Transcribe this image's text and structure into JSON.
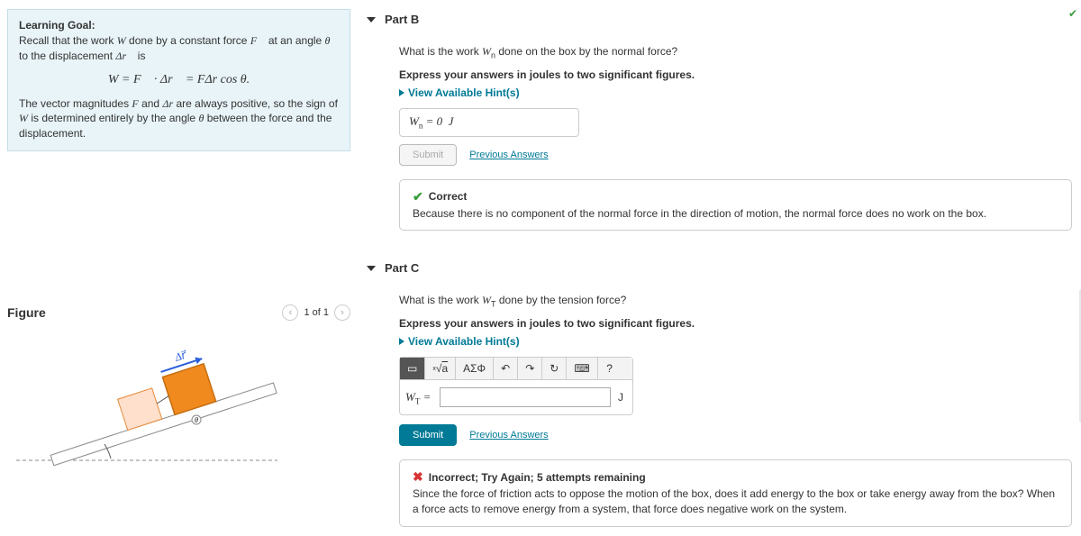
{
  "sidebar": {
    "lg_title": "Learning Goal:",
    "lg_line1_pre": "Recall that the work ",
    "lg_line1_post": " is",
    "formula": "W = F⃗ · Δr⃗ = FΔr cos θ.",
    "lg_line2": "The vector magnitudes F and Δr are always positive, so the sign of W is determined entirely by the angle θ between the force and the displacement.",
    "figure_title": "Figure",
    "figure_nav": "1 of 1"
  },
  "partB": {
    "title": "Part B",
    "question": "What is the work Wₙ done on the box by the normal force?",
    "instruction": "Express your answers in joules to two significant figures.",
    "hints": "View Available Hint(s)",
    "answer": "Wₙ = 0  J",
    "submit": "Submit",
    "prev": "Previous Answers",
    "correct": "Correct",
    "explain": "Because there is no component of the normal force in the direction of motion, the normal force does no work on the box."
  },
  "partC": {
    "title": "Part C",
    "question": "What is the work Wᴛ done by the tension force?",
    "instruction": "Express your answers in joules to two significant figures.",
    "hints": "View Available Hint(s)",
    "label": "Wᴛ =",
    "unit": "J",
    "submit": "Submit",
    "prev": "Previous Answers",
    "incorrect": "Incorrect; Try Again; 5 attempts remaining",
    "explain": "Since the force of friction acts to oppose the motion of the box, does it add energy to the box or take energy away from the box? When a force acts to remove energy from a system, that force does negative work on the system."
  },
  "tools": {
    "templates": "▭",
    "sqrt": "√",
    "greek": "ΑΣΦ",
    "undo": "↶",
    "redo": "↷",
    "reset": "↻",
    "keyboard": "⌨",
    "help": "?"
  }
}
